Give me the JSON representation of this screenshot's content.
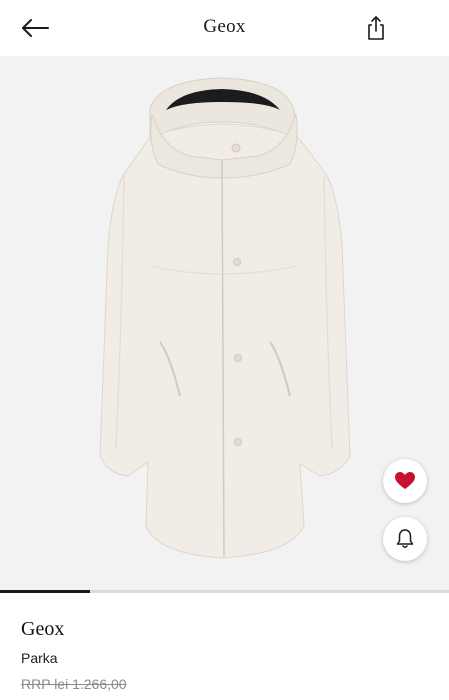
{
  "header": {
    "title": "Geox",
    "back_icon": "arrow-left-icon",
    "share_icon": "share-icon"
  },
  "gallery": {
    "image_subject": "Parka",
    "progress_fraction": 0.2,
    "favorite_icon": "heart-icon",
    "alert_icon": "bell-icon",
    "colors": {
      "favorite": "#c8102e",
      "background": "#f2f2f2",
      "coat": "#f1ede6"
    }
  },
  "product": {
    "brand": "Geox",
    "name": "Parka",
    "rrp_label": "RRP lei 1.266,00"
  }
}
